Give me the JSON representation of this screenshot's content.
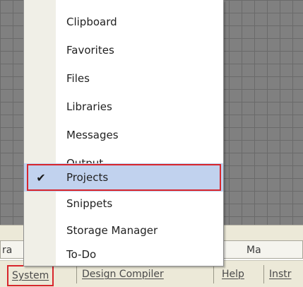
{
  "menu": {
    "items": [
      {
        "label": "Clipboard",
        "checked": false
      },
      {
        "label": "Favorites",
        "checked": false
      },
      {
        "label": "Files",
        "checked": false
      },
      {
        "label": "Libraries",
        "checked": false
      },
      {
        "label": "Messages",
        "checked": false
      },
      {
        "label": "Output",
        "checked": false
      },
      {
        "label": "Projects",
        "checked": true
      },
      {
        "label": "Snippets",
        "checked": false
      },
      {
        "label": "Storage Manager",
        "checked": false
      },
      {
        "label": "To-Do",
        "checked": false
      }
    ],
    "check_glyph": "✔"
  },
  "doc_tabs": {
    "left_label": "ra",
    "right_label": "Ma"
  },
  "bottom_tabs": [
    {
      "label": "System"
    },
    {
      "label": "Design Compiler"
    },
    {
      "label": "Help"
    },
    {
      "label": "Instr"
    }
  ],
  "colors": {
    "highlight_border": "#d8262c",
    "selected_fill": "#c1d2ee"
  }
}
